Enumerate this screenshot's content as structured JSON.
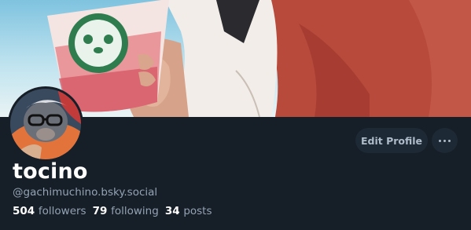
{
  "profile": {
    "display_name": "tocino",
    "handle": "@gachimuchino.bsky.social",
    "followers_count": "504",
    "followers_label": "followers",
    "following_count": "79",
    "following_label": "following",
    "posts_count": "34",
    "posts_label": "posts"
  },
  "actions": {
    "edit_profile_label": "Edit Profile",
    "more_icon": "ellipsis-icon"
  },
  "colors": {
    "background": "#161e27",
    "button_bg": "#1e2936",
    "muted_text": "#93a3b4"
  }
}
